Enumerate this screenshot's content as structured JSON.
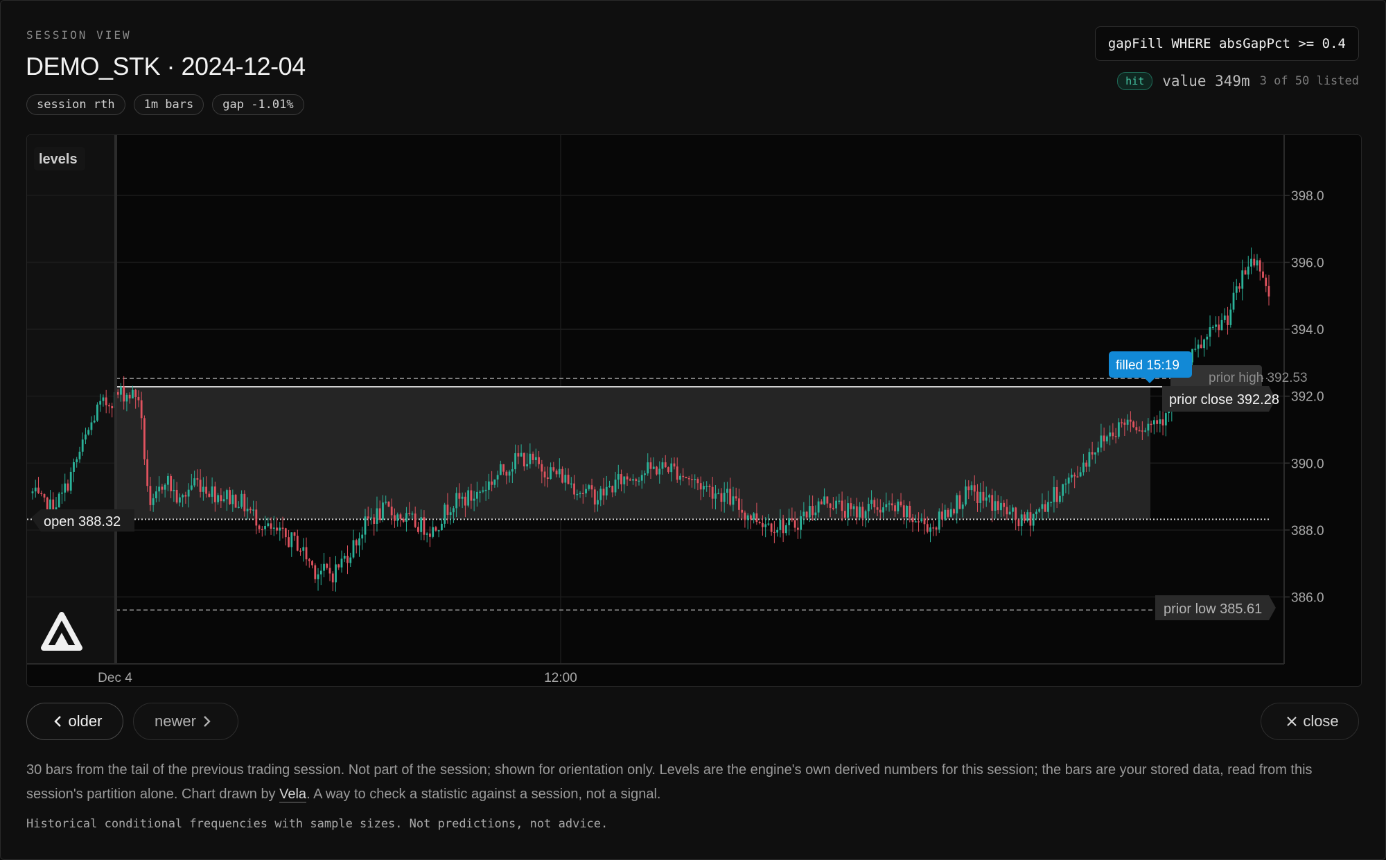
{
  "header": {
    "eyebrow": "SESSION VIEW",
    "title": "DEMO_STK · 2024-12-04",
    "chips": [
      "session rth",
      "1m bars",
      "gap -1.01%"
    ],
    "query": "gapFill WHERE absGapPct >= 0.4",
    "hit_badge": "hit",
    "value_text": "value 349m",
    "listed_text": "3 of 50 listed"
  },
  "chart_data": {
    "type": "candlestick",
    "levels_label": "levels",
    "y_axis": {
      "ticks": [
        "398.0",
        "396.0",
        "394.0",
        "392.0",
        "390.0",
        "388.0",
        "386.0"
      ],
      "ylim": [
        384.0,
        399.8
      ]
    },
    "x_axis": {
      "ticks": [
        "Dec 4",
        "12:00"
      ]
    },
    "levels": {
      "open": {
        "label": "open 388.32",
        "value": 388.32
      },
      "prior_close": {
        "label": "prior close 392.28",
        "value": 392.28
      },
      "prior_high": {
        "label": "prior high 392.53",
        "value": 392.53
      },
      "prior_low": {
        "label": "prior low 385.61",
        "value": 385.61
      }
    },
    "fill_marker": {
      "label": "filled 15:19"
    },
    "price_path": [
      [
        0,
        389.1
      ],
      [
        5,
        388.6
      ],
      [
        10,
        389.0
      ],
      [
        16,
        390.3
      ],
      [
        22,
        391.6
      ],
      [
        30,
        392.1
      ],
      [
        36,
        392.0
      ],
      [
        40,
        388.5
      ],
      [
        45,
        389.6
      ],
      [
        50,
        388.8
      ],
      [
        55,
        389.5
      ],
      [
        62,
        389.1
      ],
      [
        70,
        388.9
      ],
      [
        80,
        388.0
      ],
      [
        90,
        387.6
      ],
      [
        96,
        386.8
      ],
      [
        102,
        386.7
      ],
      [
        108,
        387.4
      ],
      [
        114,
        388.3
      ],
      [
        120,
        388.6
      ],
      [
        130,
        388.2
      ],
      [
        136,
        388.0
      ],
      [
        142,
        388.8
      ],
      [
        150,
        389.0
      ],
      [
        160,
        389.8
      ],
      [
        166,
        390.2
      ],
      [
        172,
        389.9
      ],
      [
        180,
        389.6
      ],
      [
        186,
        389.2
      ],
      [
        192,
        389.0
      ],
      [
        200,
        389.5
      ],
      [
        210,
        389.8
      ],
      [
        216,
        389.9
      ],
      [
        222,
        389.6
      ],
      [
        228,
        389.3
      ],
      [
        236,
        389.0
      ],
      [
        242,
        388.5
      ],
      [
        250,
        388.2
      ],
      [
        258,
        388.1
      ],
      [
        264,
        388.6
      ],
      [
        270,
        388.9
      ],
      [
        278,
        388.5
      ],
      [
        286,
        388.7
      ],
      [
        294,
        388.6
      ],
      [
        300,
        388.3
      ],
      [
        306,
        388.1
      ],
      [
        312,
        388.7
      ],
      [
        318,
        389.1
      ],
      [
        324,
        388.9
      ],
      [
        330,
        388.6
      ],
      [
        336,
        388.2
      ],
      [
        342,
        388.6
      ],
      [
        348,
        389.1
      ],
      [
        354,
        389.6
      ],
      [
        360,
        390.4
      ],
      [
        366,
        390.9
      ],
      [
        372,
        391.3
      ],
      [
        378,
        391.1
      ],
      [
        384,
        391.4
      ],
      [
        386,
        391.8
      ],
      [
        388,
        392.1
      ],
      [
        392,
        392.9
      ],
      [
        396,
        393.4
      ],
      [
        400,
        393.8
      ],
      [
        406,
        394.4
      ],
      [
        410,
        395.3
      ],
      [
        414,
        396.1
      ],
      [
        418,
        395.8
      ],
      [
        420,
        394.9
      ]
    ]
  },
  "controls": {
    "older_label": "older",
    "newer_label": "newer",
    "close_label": "close"
  },
  "footer": {
    "caption_before": "30 bars from the tail of the previous trading session. Not part of the session; shown for orientation only. Levels are the engine's own derived numbers for this session; the bars are your stored data, read from this session's partition alone. Chart drawn by ",
    "caption_link": "Vela",
    "caption_after": ". A way to check a statistic against a session, not a signal.",
    "disclaimer": "Historical conditional frequencies with sample sizes. Not predictions, not advice."
  },
  "colors": {
    "up": "#2bb39a",
    "down": "#e0535f",
    "accent": "#1289d6"
  }
}
